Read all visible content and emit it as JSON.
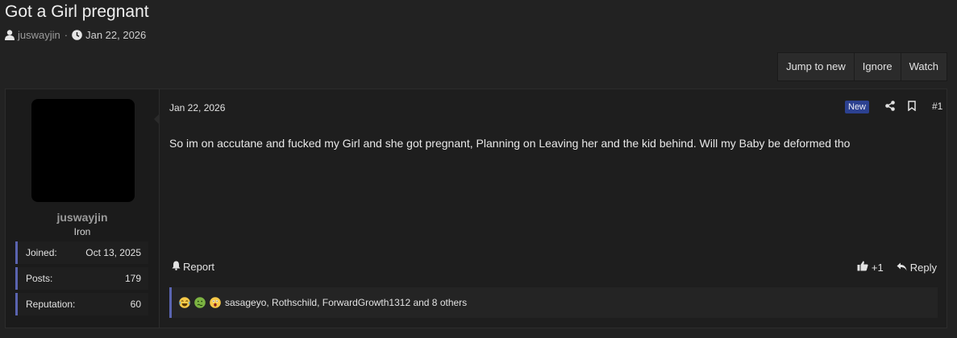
{
  "thread": {
    "title": "Got a Girl pregnant",
    "author": "juswayjin",
    "separator": "·",
    "date": "Jan 22, 2026"
  },
  "toolbar": {
    "jump_label": "Jump to new",
    "ignore_label": "Ignore",
    "watch_label": "Watch"
  },
  "post": {
    "date": "Jan 22, 2026",
    "new_badge": "New",
    "number": "#1",
    "body": "So im on accutane and fucked my Girl and she got pregnant, Planning on Leaving her and the kid behind. Will my Baby be deformed tho",
    "report_label": "Report",
    "like_label": "+1",
    "reply_label": "Reply",
    "reactions_text": "sasageyo, Rothschild, ForwardGrowth1312 and 8 others",
    "reaction_icons": [
      "joy-emoji",
      "nauseated-emoji",
      "astonished-emoji"
    ]
  },
  "user": {
    "name": "juswayjin",
    "rank": "Iron",
    "stats": [
      {
        "label": "Joined:",
        "value": "Oct 13, 2025"
      },
      {
        "label": "Posts:",
        "value": "179"
      },
      {
        "label": "Reputation:",
        "value": "60"
      }
    ]
  },
  "colors": {
    "accent": "#5a64b0",
    "new_badge": "#2c4190",
    "background": "#222222"
  }
}
